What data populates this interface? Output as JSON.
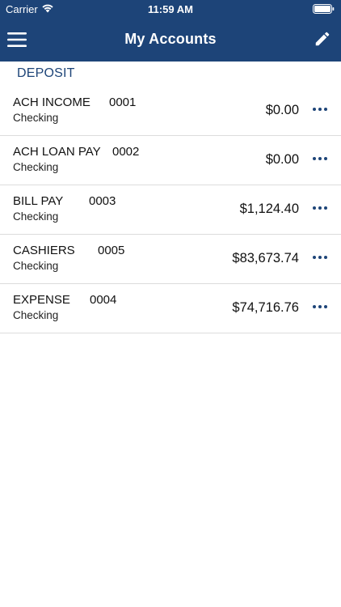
{
  "status_bar": {
    "carrier": "Carrier",
    "time": "11:59 AM"
  },
  "nav": {
    "title": "My Accounts",
    "menu_icon": "hamburger-menu-icon",
    "edit_icon": "pencil-icon"
  },
  "section": {
    "title": "DEPOSIT"
  },
  "accounts": [
    {
      "name": "ACH INCOME",
      "number": "0001",
      "type": "Checking",
      "balance": "$0.00"
    },
    {
      "name": "ACH LOAN PAY",
      "number": "0002",
      "type": "Checking",
      "balance": "$0.00"
    },
    {
      "name": "BILL PAY",
      "number": "0003",
      "type": "Checking",
      "balance": "$1,124.40"
    },
    {
      "name": "CASHIERS",
      "number": "0005",
      "type": "Checking",
      "balance": "$83,673.74"
    },
    {
      "name": "EXPENSE",
      "number": "0004",
      "type": "Checking",
      "balance": "$74,716.76"
    }
  ],
  "colors": {
    "brand": "#1d4478",
    "divider": "#dcdcdc"
  }
}
